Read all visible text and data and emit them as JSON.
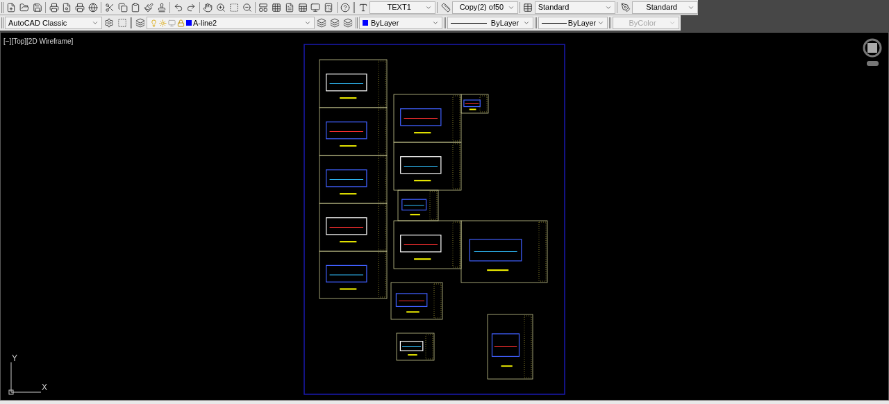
{
  "toolbar_top": {
    "text_style": {
      "value": "TEXT1"
    },
    "dim_style": {
      "value": "Copy(2) of50"
    },
    "table_style": {
      "value": "Standard"
    },
    "multileader_style": {
      "value": "Standard"
    }
  },
  "toolbar_bottom": {
    "workspace": {
      "value": "AutoCAD Classic"
    },
    "layer": {
      "value": "A-line2",
      "color": "#0000ff"
    },
    "properties": [
      {
        "kind": "color",
        "value": "ByLayer",
        "color": "#0000ff",
        "disabled": false
      },
      {
        "kind": "linetype",
        "value": "ByLayer",
        "disabled": false
      },
      {
        "kind": "lineweight",
        "value": "ByLayer",
        "disabled": false
      },
      {
        "kind": "plain",
        "value": "ByColor",
        "disabled": true
      }
    ]
  },
  "viewport": {
    "label": "[−][Top][2D Wireframe]",
    "ucs": {
      "x_label": "X",
      "y_label": "Y"
    }
  }
}
